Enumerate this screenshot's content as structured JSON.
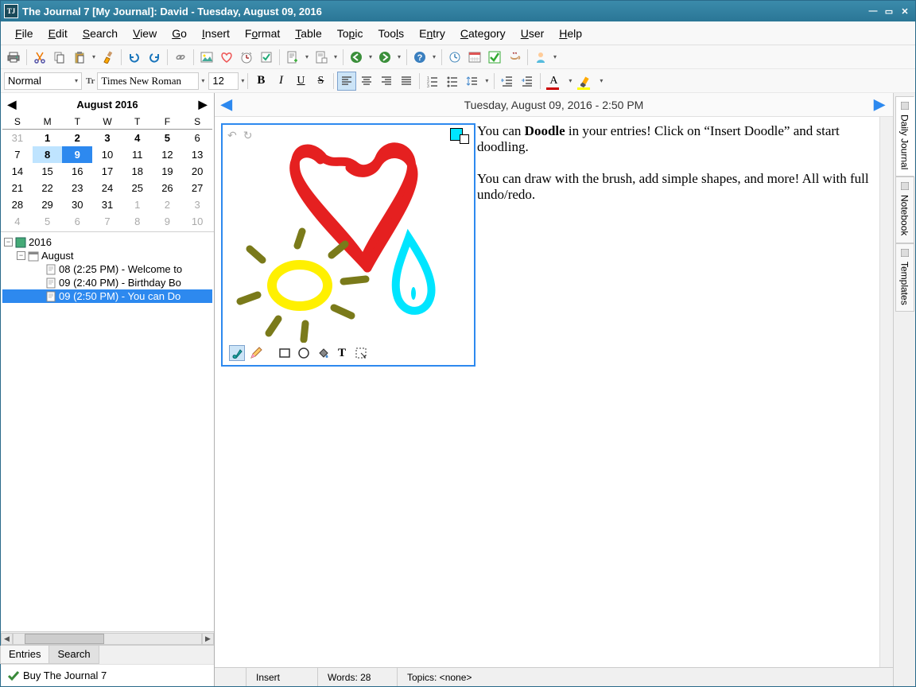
{
  "window": {
    "title": "The Journal 7 [My Journal]: David - Tuesday, August 09, 2016",
    "app_icon_text": "TJ"
  },
  "menu": {
    "items": [
      "File",
      "Edit",
      "Search",
      "View",
      "Go",
      "Insert",
      "Format",
      "Table",
      "Topic",
      "Tools",
      "Entry",
      "Category",
      "User",
      "Help"
    ]
  },
  "format_bar": {
    "style": "Normal",
    "font": "Times New Roman",
    "font_prefix_icon": "Tr",
    "size": "12"
  },
  "calendar": {
    "month_label": "August 2016",
    "dow": [
      "S",
      "M",
      "T",
      "W",
      "T",
      "F",
      "S"
    ],
    "weeks": [
      [
        {
          "d": "31",
          "other": true
        },
        {
          "d": "1",
          "bold": true
        },
        {
          "d": "2",
          "bold": true
        },
        {
          "d": "3",
          "bold": true
        },
        {
          "d": "4",
          "bold": true
        },
        {
          "d": "5",
          "bold": true
        },
        {
          "d": "6"
        }
      ],
      [
        {
          "d": "7"
        },
        {
          "d": "8",
          "bold": true,
          "today": true
        },
        {
          "d": "9",
          "bold": true,
          "selected": true
        },
        {
          "d": "10"
        },
        {
          "d": "11"
        },
        {
          "d": "12"
        },
        {
          "d": "13"
        }
      ],
      [
        {
          "d": "14"
        },
        {
          "d": "15"
        },
        {
          "d": "16"
        },
        {
          "d": "17"
        },
        {
          "d": "18"
        },
        {
          "d": "19"
        },
        {
          "d": "20"
        }
      ],
      [
        {
          "d": "21"
        },
        {
          "d": "22"
        },
        {
          "d": "23"
        },
        {
          "d": "24"
        },
        {
          "d": "25"
        },
        {
          "d": "26"
        },
        {
          "d": "27"
        }
      ],
      [
        {
          "d": "28"
        },
        {
          "d": "29"
        },
        {
          "d": "30"
        },
        {
          "d": "31"
        },
        {
          "d": "1",
          "other": true
        },
        {
          "d": "2",
          "other": true
        },
        {
          "d": "3",
          "other": true
        }
      ],
      [
        {
          "d": "4",
          "other": true
        },
        {
          "d": "5",
          "other": true
        },
        {
          "d": "6",
          "other": true
        },
        {
          "d": "7",
          "other": true
        },
        {
          "d": "8",
          "other": true
        },
        {
          "d": "9",
          "other": true
        },
        {
          "d": "10",
          "other": true
        }
      ]
    ]
  },
  "tree": {
    "year": "2016",
    "month": "August",
    "entries": [
      {
        "label": "08 (2:25 PM) - Welcome to"
      },
      {
        "label": "09 (2:40 PM) - Birthday Bo"
      },
      {
        "label": "09 (2:50 PM) - You can Do",
        "selected": true
      }
    ]
  },
  "left_tabs": {
    "entries": "Entries",
    "search": "Search",
    "active": "search"
  },
  "buy_text": "Buy The Journal 7",
  "entry": {
    "header": "Tuesday, August 09, 2016 - 2:50 PM",
    "para1_a": "You can ",
    "para1_bold": "Doodle",
    "para1_b": " in your entries! Click on “Insert Doodle” and start doodling.",
    "para2": "You can draw with the brush, add simple shapes, and more! All with full undo/redo."
  },
  "right_tabs": [
    "Daily Journal",
    "Notebook",
    "Templates"
  ],
  "status": {
    "insert": "Insert",
    "words": "Words: 28",
    "topics": "Topics: <none>"
  },
  "colors": {
    "accent": "#2d89ef",
    "heart": "#e52020",
    "sun_yellow": "#fff000",
    "sun_rays": "#7a7a1a",
    "drop": "#00e5ff",
    "font_color_bar": "#c00000",
    "highlight_bar": "#ffff00"
  }
}
